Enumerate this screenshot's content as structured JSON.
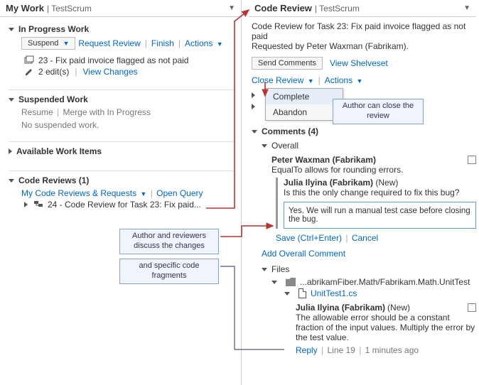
{
  "left": {
    "title": "My Work",
    "context": "| TestScrum",
    "in_progress": {
      "heading": "In Progress Work",
      "suspend": "Suspend",
      "request": "Request Review",
      "finish": "Finish",
      "actions": "Actions",
      "task_text": "23 - Fix paid invoice flagged as not paid",
      "edits_text": "2 edit(s)",
      "view_changes": "View Changes"
    },
    "suspended": {
      "heading": "Suspended Work",
      "resume": "Resume",
      "merge": "Merge with In Progress",
      "empty": "No suspended work."
    },
    "available": {
      "heading": "Available Work Items"
    },
    "reviews": {
      "heading": "Code Reviews (1)",
      "my_reviews": "My Code Reviews & Requests",
      "open_query": "Open Query",
      "item_text": "24 - Code Review for Task 23: Fix paid..."
    }
  },
  "right": {
    "title": "Code Review",
    "context": "| TestScrum",
    "desc_line1": "Code Review for Task 23: Fix paid invoice flagged as not paid",
    "desc_line2": "Requested by Peter Waxman (Fabrikam).",
    "send": "Send Comments",
    "view_shelve": "View Shelveset",
    "close_review": "Close Review",
    "actions": "Actions",
    "menu": {
      "complete": "Complete",
      "abandon": "Abandon"
    },
    "comments_heading": "Comments (4)",
    "overall_heading": "Overall",
    "c1_author": "Peter Waxman (Fabrikam)",
    "c1_body": "EqualTo allows for rounding errors.",
    "c1r_author": "Julia Ilyina (Fabrikam)",
    "c1r_tag": "(New)",
    "c1r_body": "Is this the only change required to fix this bug?",
    "reply_box": "Yes. We will run a manual test case before closing the bug.",
    "save": "Save (Ctrl+Enter)",
    "cancel": "Cancel",
    "add_overall": "Add Overall Comment",
    "files_heading": "Files",
    "file_path": "...abrikamFiber.Math/Fabrikam.Math.UnitTest",
    "file_name": "UnitTest1.cs",
    "fc_author": "Julia Ilyina (Fabrikam)",
    "fc_tag": "(New)",
    "fc_body": "The allowable error should be a constant fraction of the input values. Multiply the error by the test value.",
    "fc_reply": "Reply",
    "fc_line": "Line 19",
    "fc_time": "1 minutes ago"
  },
  "callouts": {
    "close": "Author can close the review",
    "discuss": "Author and reviewers discuss the changes",
    "frag": "and specific code fragments"
  }
}
